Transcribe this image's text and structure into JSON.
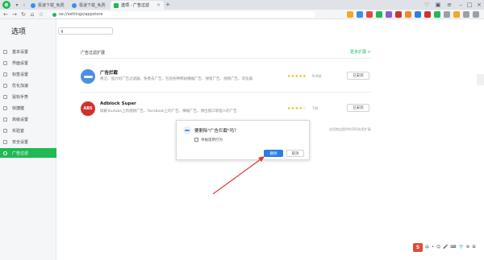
{
  "browser": {
    "tabs": [
      {
        "title": "极速下载_免费软件下载_极速...",
        "favicon_color": "#3a8ee6",
        "active": false
      },
      {
        "title": "极速下载_免费软件下载_极速...",
        "favicon_color": "#3a8ee6",
        "active": false
      },
      {
        "title": "选项 - 广告过滤",
        "favicon_color": "#1fb955",
        "active": true
      }
    ],
    "new_tab": "+",
    "url": "se://settings/appstore"
  },
  "sidebar": {
    "title": "选项",
    "items": [
      {
        "label": "基本设置",
        "active": false
      },
      {
        "label": "界面设置",
        "active": false
      },
      {
        "label": "标签设置",
        "active": false
      },
      {
        "label": "优化加速",
        "active": false
      },
      {
        "label": "鼠标手势",
        "active": false
      },
      {
        "label": "快捷键",
        "active": false
      },
      {
        "label": "高级设置",
        "active": false
      },
      {
        "label": "实验室",
        "active": false
      },
      {
        "label": "安全设置",
        "active": false
      },
      {
        "label": "广告过滤",
        "active": true
      }
    ]
  },
  "search": {
    "placeholder": ""
  },
  "main": {
    "section_title": "广告过滤扩展",
    "more_link": "更多扩展 >",
    "extensions": [
      {
        "name": "广告拦截",
        "description": "简洁、强力的广告过滤器。免费去广告，包括各种网站横幅广告、弹窗广告、视频广告、浏览器...",
        "stars": "★★★★★",
        "rating": "9.9分",
        "button": "已安装",
        "icon_color": "#4a90e2",
        "icon_text": ""
      },
      {
        "name": "Adblock Super",
        "description": "屏蔽Youtube上的视频广告，Facebook上的广告，横幅广告，弹出窗口等恼人的广告",
        "stars": "★★★★☆",
        "rating": "7分",
        "button": "已安装",
        "icon_color": "#d0312d",
        "icon_text": "ABS"
      }
    ],
    "footer_note": "应用商店提供的360应用扩展"
  },
  "dialog": {
    "title": "要删除\"广告拦截\"吗？",
    "checkbox_label": "举报滥用行为",
    "confirm": "删除",
    "cancel": "取消"
  },
  "tray": {
    "logo": "S",
    "items": [
      "中",
      "•",
      "☺",
      "🎤",
      "⌨",
      "👕",
      "⚙",
      "⊞"
    ]
  }
}
